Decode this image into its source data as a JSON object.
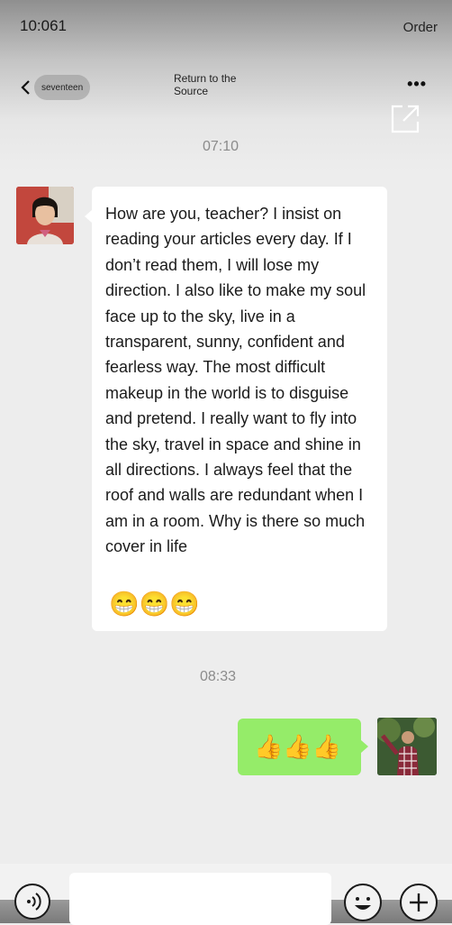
{
  "status_bar": {
    "time": "10:061",
    "right_label": "Order"
  },
  "nav": {
    "back_label": "seventeen",
    "title_line1": "Return to the",
    "title_line2": "Source",
    "more_label": "•••"
  },
  "messages": [
    {
      "type": "timestamp",
      "text": "07:10"
    },
    {
      "type": "incoming",
      "text": "How are you, teacher? I insist on reading your articles every day. If I don’t read them, I will lose my direction. I also like to make my soul face up to the sky, live in a transparent, sunny, confident and fearless way. The most difficult makeup in the world is to disguise and pretend. I really want to fly into the sky, travel in space and shine in all directions. I always feel that the roof and walls are redundant when I am in a room. Why is there so much cover in life",
      "emoji": "😁😁😁"
    },
    {
      "type": "timestamp",
      "text": "08:33"
    },
    {
      "type": "outgoing",
      "emoji": "👍👍👍"
    }
  ],
  "input": {
    "value": "",
    "placeholder": ""
  },
  "icons": {
    "back": "chevron-left-icon",
    "more": "more-dots-icon",
    "external": "external-link-icon",
    "voice": "voice-icon",
    "emoji": "emoji-icon",
    "plus": "plus-icon"
  },
  "colors": {
    "outgoing_bubble": "#95ec69",
    "incoming_bubble": "#ffffff",
    "background": "#ededed"
  }
}
